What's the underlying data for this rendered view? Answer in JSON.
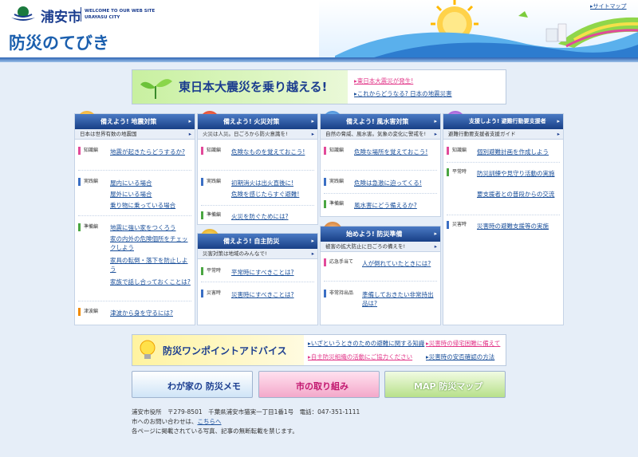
{
  "header": {
    "city_name": "浦安市",
    "welcome_line1": "WELCOME TO OUR WEB SITE",
    "welcome_line2": "URAYASU CITY",
    "site_title": "防災のてびき",
    "sitemap_link": "▸サイトマップ"
  },
  "top_banner": {
    "title": "東日本大震災を乗り越える!",
    "links": [
      "▸東日本大震災が発生!",
      "▸これからどうなる? 日本の地震災害"
    ]
  },
  "columns": [
    {
      "id": "jishin",
      "heading": "備えよう! 地震対策",
      "subtitle": "日本は世界有数の地震国",
      "groups": [
        {
          "tag": "知識編",
          "links": [
            "地震が起きたらどうするか?"
          ]
        },
        {
          "tag": "実践編",
          "links": [
            "屋内にいる場合",
            "屋外にいる場合",
            "乗り物に乗っている場合"
          ]
        },
        {
          "tag": "準備編",
          "links": [
            "地震に強い家をつくろう",
            "家の内外の危険個所をチェックしよう",
            "家具の転倒・落下を防止しよう",
            "家族で話し合っておくことは?"
          ]
        },
        {
          "tag": "津波編",
          "links": [
            "津波から身を守るには?"
          ]
        }
      ]
    },
    {
      "id": "kasai",
      "heading": "備えよう! 火災対策",
      "subtitle": "火災は人災。日ごろから防火意識を!",
      "groups": [
        {
          "tag": "知識編",
          "links": [
            "危険なものを覚えておこう!"
          ]
        },
        {
          "tag": "実践編",
          "links": [
            "初期消火は出火直後に!",
            "危険を感じたらすぐ避難!"
          ]
        },
        {
          "tag": "準備編",
          "links": [
            "火災を防ぐためには?"
          ]
        }
      ]
    },
    {
      "id": "jishu",
      "heading": "備えよう! 自主防災",
      "subtitle": "災害対策は地域のみんなで!",
      "groups": [
        {
          "tag": "平常時",
          "links": [
            "平常時にすべきことは?"
          ]
        },
        {
          "tag": "災害時",
          "links": [
            "災害時にすべきことは?"
          ]
        }
      ]
    },
    {
      "id": "fusuigai",
      "heading": "備えよう! 風水害対策",
      "subtitle": "自然の脅威、風水害。気象の変化に警戒を!",
      "groups": [
        {
          "tag": "知識編",
          "links": [
            "危険な場所を覚えておこう!"
          ]
        },
        {
          "tag": "実践編",
          "links": [
            "危険は急激に迫ってくる!"
          ]
        },
        {
          "tag": "準備編",
          "links": [
            "風水害にどう備えるか?"
          ]
        }
      ]
    },
    {
      "id": "junbi",
      "heading": "始めよう! 防災準備",
      "subtitle": "被害の拡大防止に日ごろの備えを!",
      "groups": [
        {
          "tag": "応急手当て",
          "links": [
            "人が倒れていたときには?"
          ]
        },
        {
          "tag": "非常持出品",
          "links": [
            "準備しておきたい非常持出品は?"
          ]
        }
      ]
    },
    {
      "id": "shien",
      "heading": "支援しよう! 避難行動要支援者",
      "subtitle": "避難行動要支援者支援ガイド",
      "groups": [
        {
          "tag": "知識編",
          "links": [
            "個別避難計画を作成しよう"
          ]
        },
        {
          "tag": "平常時",
          "links": [
            "防災訓練や見守り活動の実施",
            "要支援者との普段からの交流"
          ]
        },
        {
          "tag": "災害時",
          "links": [
            "災害時の避難支援等の実施"
          ]
        }
      ]
    }
  ],
  "advice_banner": {
    "title": "防災ワンポイントアドバイス",
    "links": [
      "▸いざというときのための避難に関する知識",
      "▸災害時の帰宅困難に備えて",
      "▸自主防災組織の活動にご協力ください",
      "▸災害時の安否確認の方法"
    ]
  },
  "bottom_buttons": {
    "memo": "わが家の 防災メモ",
    "torikumi": "市の取り組み",
    "map": "MAP 防災マップ"
  },
  "footer": {
    "address": "浦安市役所　〒279-8501　千葉県浦安市猫実一丁目1番1号　電話：047-351-1111",
    "contact_prefix": "市へのお問い合わせは、",
    "contact_link": "こちらへ",
    "copyright": "各ページに掲載されている写真、記事の無断転載を禁じます。"
  },
  "colors": {
    "brand": "#1b3d8f",
    "accent": "#2d64b4"
  }
}
